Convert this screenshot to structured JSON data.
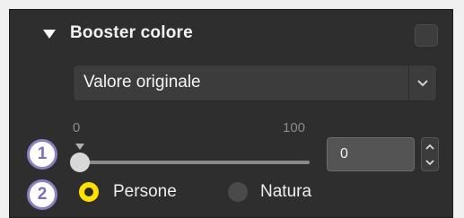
{
  "section": {
    "title": "Booster colore",
    "enabled": false
  },
  "preset": {
    "value": "Valore originale"
  },
  "slider": {
    "min_label": "0",
    "max_label": "100",
    "min": 0,
    "max": 100,
    "value": 0
  },
  "number_input": {
    "value": "0"
  },
  "callouts": {
    "one": "1",
    "two": "2"
  },
  "radios": [
    {
      "label": "Persone",
      "selected": true
    },
    {
      "label": "Natura",
      "selected": false
    }
  ],
  "colors": {
    "panel_bg": "#303030",
    "radio_selected": "#ffe100",
    "callout_accent": "#8a80c4"
  },
  "icons": {
    "collapse": "triangle-down-icon",
    "dropdown": "chevron-down-icon",
    "step_up": "chevron-up-icon",
    "step_down": "chevron-down-icon"
  }
}
